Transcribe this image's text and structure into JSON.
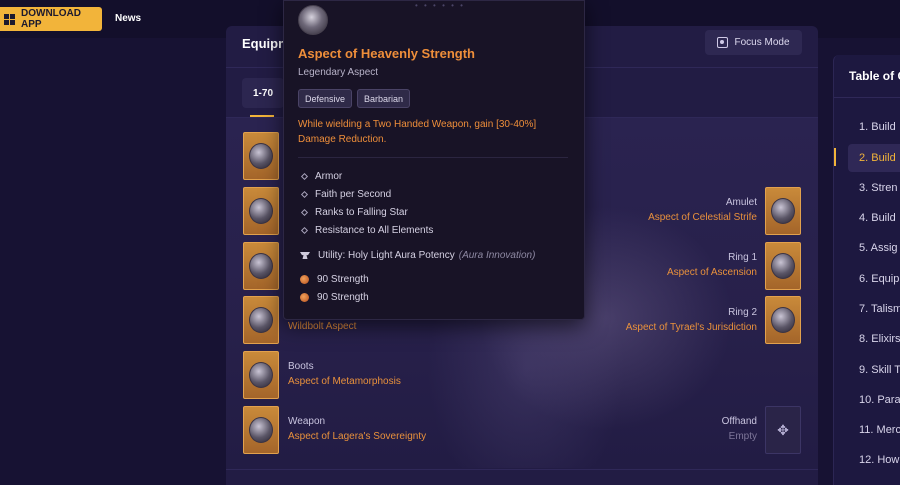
{
  "topbar": {
    "download_label": "DOWNLOAD APP",
    "news_label": "News"
  },
  "panel": {
    "title": "Equipm",
    "focus_label": "Focus Mode",
    "tab_label": "1-70"
  },
  "slots_left": [
    {
      "label": "",
      "aspect": ""
    },
    {
      "label": "",
      "aspect": ""
    },
    {
      "label": "",
      "aspect": ""
    },
    {
      "label": "",
      "aspect": "Wildbolt Aspect"
    },
    {
      "label": "Boots",
      "aspect": "Aspect of Metamorphosis"
    },
    {
      "label": "Weapon",
      "aspect": "Aspect of Lagera's Sovereignty"
    }
  ],
  "slots_right": [
    {
      "label": "Amulet",
      "aspect": "Aspect of Celestial Strife"
    },
    {
      "label": "Ring 1",
      "aspect": "Aspect of Ascension"
    },
    {
      "label": "Ring 2",
      "aspect": "Aspect of Tyrael's Jurisdiction"
    },
    {
      "label": "Offhand",
      "aspect": "Empty"
    }
  ],
  "toc": {
    "title": "Table of C",
    "items": [
      "1. Build",
      "2. Build",
      "3. Stren",
      "4. Build",
      "5. Assig",
      "6. Equip",
      "7. Talism",
      "8. Elixirs",
      "9. Skill T",
      "10. Para",
      "11. Merc",
      "12. How"
    ]
  },
  "tooltip": {
    "title": "Aspect of Heavenly Strength",
    "subtitle": "Legendary Aspect",
    "tags": [
      "Defensive",
      "Barbarian"
    ],
    "description": "While wielding a Two Handed Weapon, gain [30-40%] Damage Reduction.",
    "stats": [
      "Armor",
      "Faith per Second",
      "Ranks to Falling Star",
      "Resistance to All Elements"
    ],
    "utility": "Utility: Holy Light Aura Potency",
    "utility_note": "(Aura Innovation)",
    "strength": [
      "90 Strength",
      "90 Strength"
    ]
  },
  "colors": {
    "accent": "#f2b43a",
    "aspect_orange": "#e9913c",
    "background": "#171233"
  }
}
